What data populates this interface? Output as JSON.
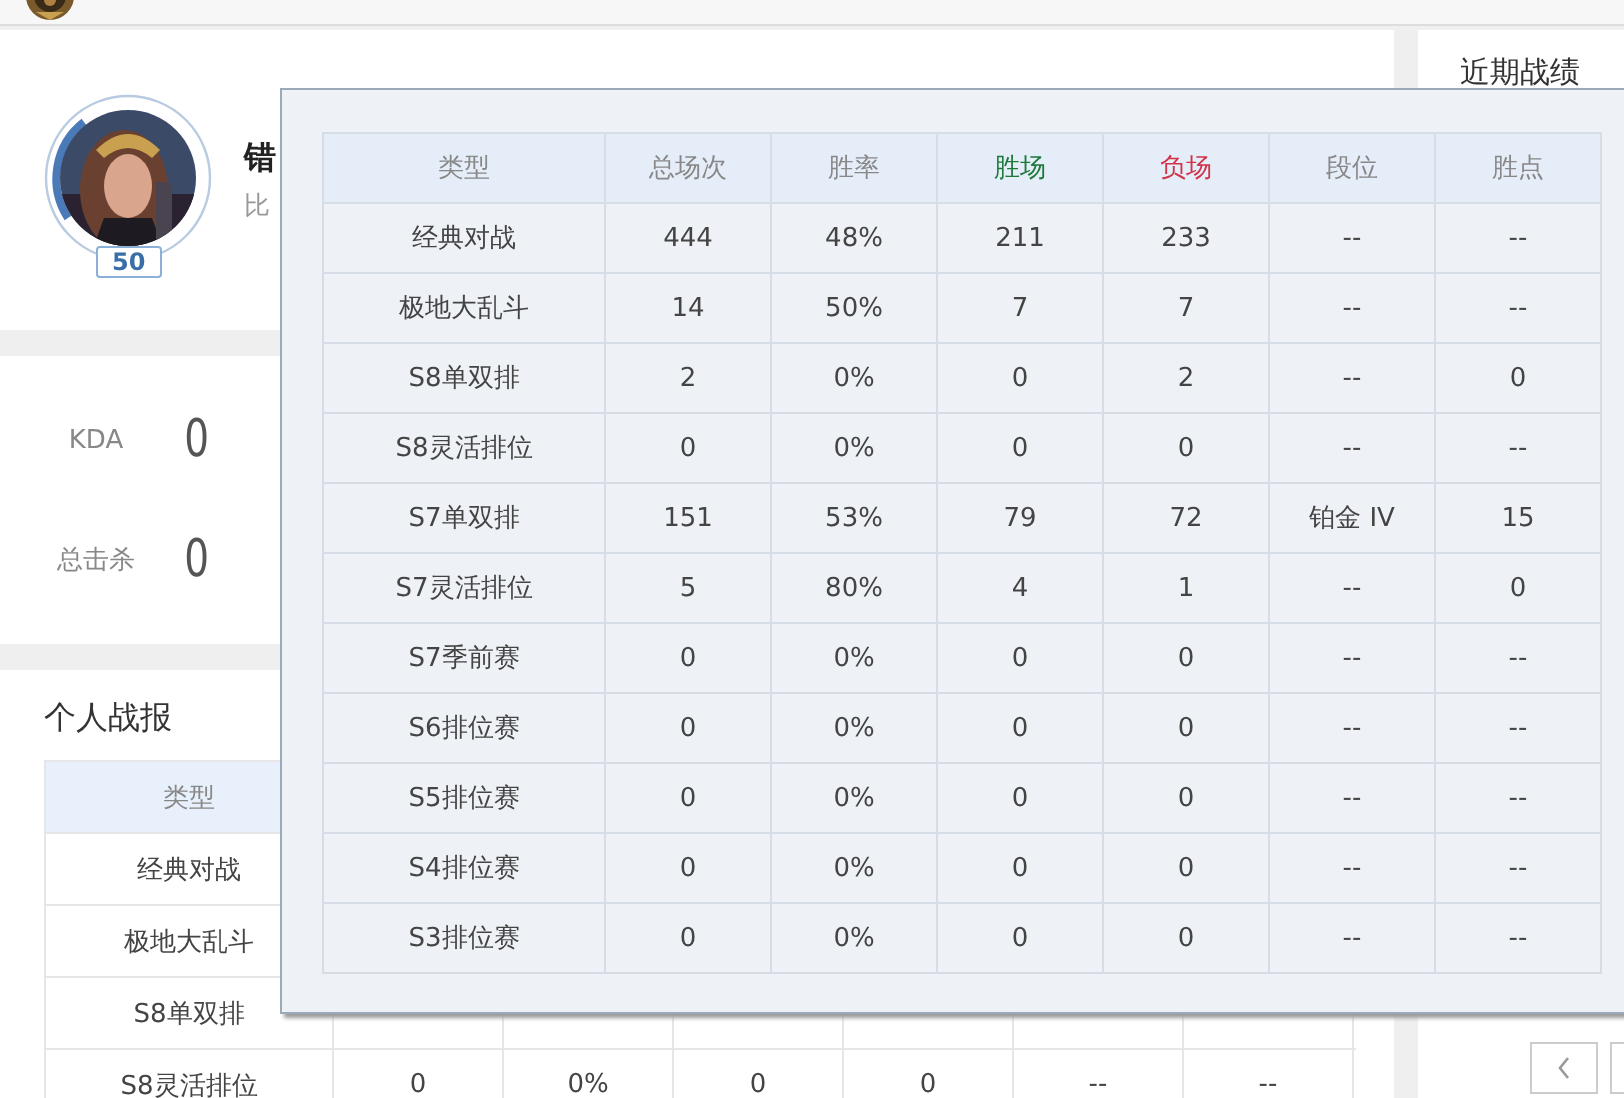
{
  "profile": {
    "name": "错",
    "subtitle": "比",
    "level": "50"
  },
  "stats": [
    {
      "label": "KDA",
      "value": "0"
    },
    {
      "label": "总击杀",
      "value": "0"
    }
  ],
  "report": {
    "title": "个人战报",
    "columns": [
      "类型"
    ],
    "rows": [
      {
        "cells": [
          "经典对战"
        ]
      },
      {
        "cells": [
          "极地大乱斗"
        ]
      },
      {
        "cells": [
          "S8单双排"
        ]
      },
      {
        "cells": [
          "S8灵活排位",
          "0",
          "0%",
          "0",
          "0",
          "--",
          "--"
        ]
      }
    ]
  },
  "recent": {
    "title": "近期战绩"
  },
  "popup": {
    "columns": [
      {
        "label": "类型",
        "color": "#888888"
      },
      {
        "label": "总场次",
        "color": "#888888"
      },
      {
        "label": "胜率",
        "color": "#888888"
      },
      {
        "label": "胜场",
        "color": "#1e7a3c"
      },
      {
        "label": "负场",
        "color": "#d0334a"
      },
      {
        "label": "段位",
        "color": "#888888"
      },
      {
        "label": "胜点",
        "color": "#888888"
      }
    ],
    "rows": [
      [
        "经典对战",
        "444",
        "48%",
        "211",
        "233",
        "--",
        "--"
      ],
      [
        "极地大乱斗",
        "14",
        "50%",
        "7",
        "7",
        "--",
        "--"
      ],
      [
        "S8单双排",
        "2",
        "0%",
        "0",
        "2",
        "--",
        "0"
      ],
      [
        "S8灵活排位",
        "0",
        "0%",
        "0",
        "0",
        "--",
        "--"
      ],
      [
        "S7单双排",
        "151",
        "53%",
        "79",
        "72",
        "铂金 IV",
        "15"
      ],
      [
        "S7灵活排位",
        "5",
        "80%",
        "4",
        "1",
        "--",
        "0"
      ],
      [
        "S7季前赛",
        "0",
        "0%",
        "0",
        "0",
        "--",
        "--"
      ],
      [
        "S6排位赛",
        "0",
        "0%",
        "0",
        "0",
        "--",
        "--"
      ],
      [
        "S5排位赛",
        "0",
        "0%",
        "0",
        "0",
        "--",
        "--"
      ],
      [
        "S4排位赛",
        "0",
        "0%",
        "0",
        "0",
        "--",
        "--"
      ],
      [
        "S3排位赛",
        "0",
        "0%",
        "0",
        "0",
        "--",
        "--"
      ]
    ]
  }
}
